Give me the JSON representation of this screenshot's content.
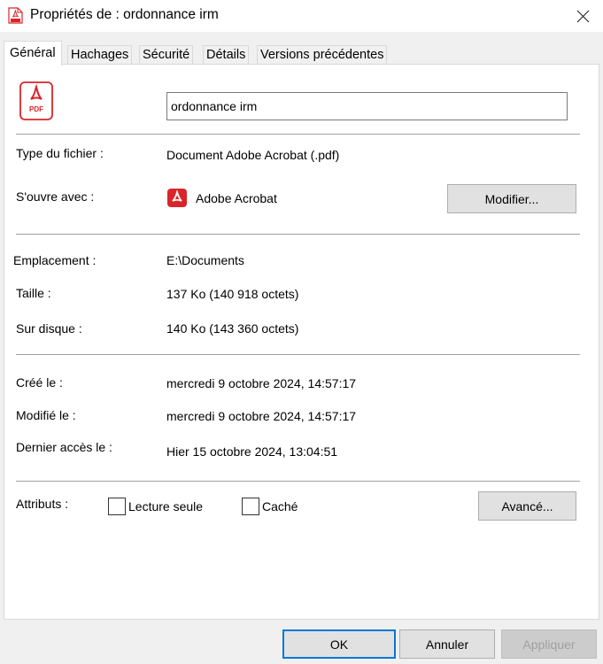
{
  "window": {
    "title": "Propriétés de : ordonnance irm"
  },
  "tabs": [
    {
      "label": "Général",
      "active": true
    },
    {
      "label": "Hachages",
      "active": false
    },
    {
      "label": "Sécurité",
      "active": false
    },
    {
      "label": "Détails",
      "active": false
    },
    {
      "label": "Versions précédentes",
      "active": false
    }
  ],
  "general": {
    "file_name": "ordonnance irm",
    "file_type_label": "Type du fichier :",
    "file_type_value": "Document Adobe Acrobat (.pdf)",
    "opens_with_label": "S'ouvre avec :",
    "opens_with_value": "Adobe Acrobat",
    "change_button": "Modifier...",
    "location_label": "Emplacement :",
    "location_value": "E:\\Documents",
    "size_label": "Taille :",
    "size_value": "137 Ko (140 918 octets)",
    "disk_label": "Sur disque :",
    "disk_value": "140 Ko (143 360 octets)",
    "created_label": "Créé le :",
    "created_value": "mercredi 9 octobre 2024, 14:57:17",
    "modified_label": "Modifié le :",
    "modified_value": "mercredi 9 octobre 2024, 14:57:17",
    "accessed_label": "Dernier accès le :",
    "accessed_value": "Hier 15 octobre 2024, 13:04:51",
    "attributes_label": "Attributs :",
    "readonly_label": "Lecture seule",
    "readonly_checked": false,
    "hidden_label": "Caché",
    "hidden_checked": false,
    "advanced_button": "Avancé...",
    "pdf_badge": "PDF"
  },
  "footer": {
    "ok": "OK",
    "cancel": "Annuler",
    "apply": "Appliquer"
  },
  "colors": {
    "pdf_red": "#d9252a",
    "accent": "#0078d7"
  },
  "icons": {
    "title": "pdf-file-icon",
    "file": "pdf-file-icon",
    "app": "adobe-acrobat-icon",
    "close": "close-icon"
  }
}
